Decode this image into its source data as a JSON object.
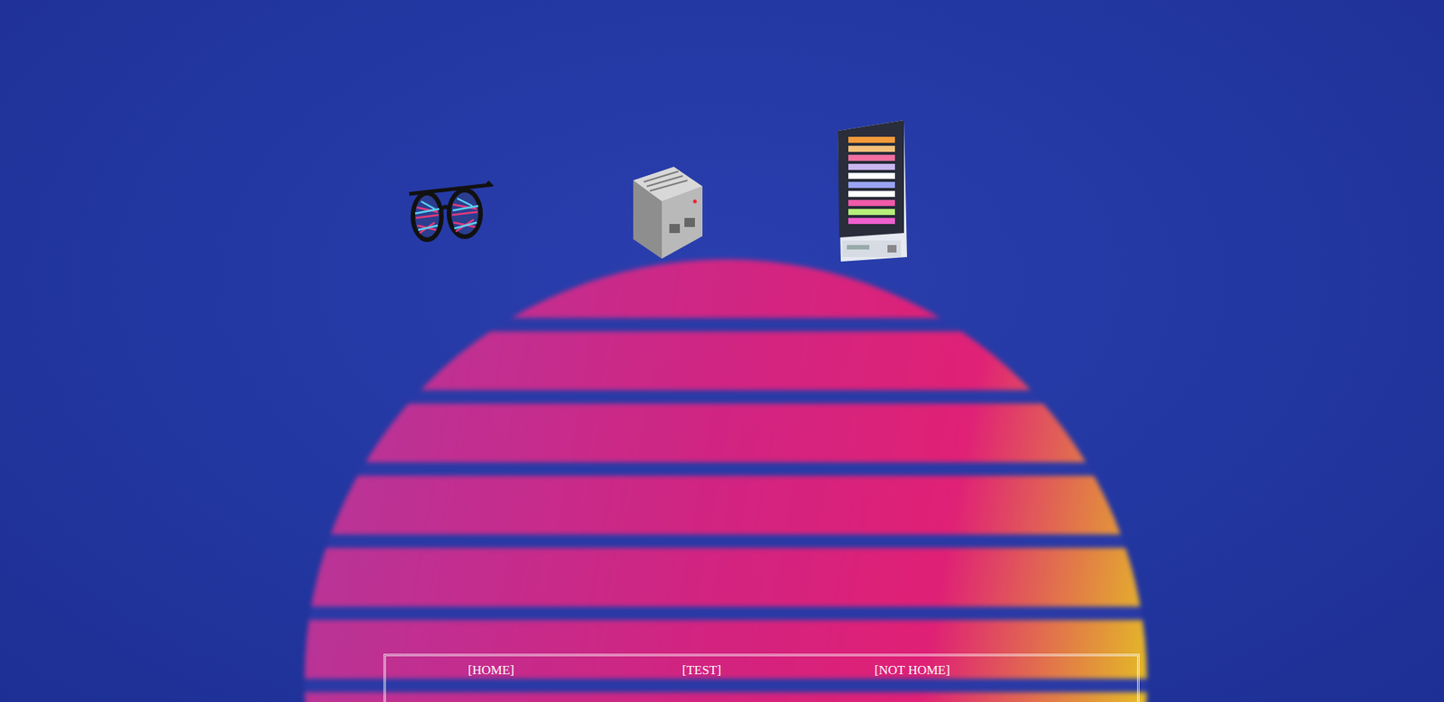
{
  "nav": [
    {
      "label": "[HOME]"
    },
    {
      "label": "[TEST]"
    },
    {
      "label": "[NOT HOME]"
    }
  ]
}
